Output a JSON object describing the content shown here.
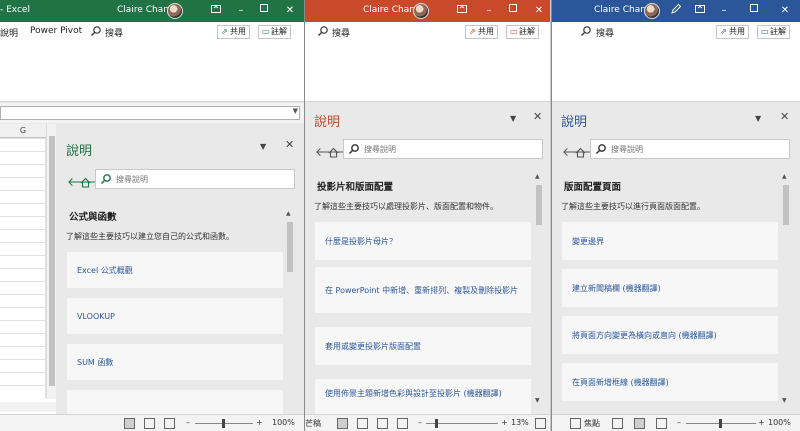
{
  "excel": {
    "title": "- Excel",
    "user": "Claire Chang",
    "ribbon_tabs": [
      "說明",
      "Power Pivot"
    ],
    "search_icon": "search-icon",
    "share_label": "共用",
    "comment_label": "註解",
    "column_header": "G",
    "help": {
      "title": "說明",
      "search_placeholder": "搜尋說明",
      "section_title": "公式與函數",
      "section_desc": "了解這些主要技巧以建立您自己的公式和函數。",
      "items": [
        "Excel 公式概觀",
        "VLOOKUP",
        "SUM 函數"
      ]
    },
    "zoom": "100%"
  },
  "powerpoint": {
    "user": "Claire Chang",
    "share_label": "共用",
    "comment_label": "註解",
    "help": {
      "title": "說明",
      "search_placeholder": "搜尋說明",
      "section_title": "投影片和版面配置",
      "section_desc": "了解這些主要技巧以處理投影片、版面配置和物件。",
      "items": [
        "什麼是投影片母片？",
        "在 PowerPoint 中新增、重新排列、複製及刪除投影片",
        "套用或變更投影片版面配置",
        "使用佈景主題新增色彩與設計至投影片 (機器翻譯)"
      ]
    },
    "status_left": "芒稿",
    "zoom": "13%"
  },
  "word": {
    "user": "Claire Chang",
    "share_label": "共用",
    "comment_label": "註解",
    "help": {
      "title": "說明",
      "search_placeholder": "搜尋說明",
      "section_title": "版面配置頁面",
      "section_desc": "了解這些主要技巧以進行頁面版面配置。",
      "items": [
        "變更邊界",
        "建立新聞稿欄 (機器翻譯)",
        "將頁面方向變更為橫向或直向 (機器翻譯)",
        "在頁面新增框線 (機器翻譯)"
      ]
    },
    "focus_label": "焦點",
    "zoom": "100%"
  },
  "colors": {
    "excel": "#217346",
    "powerpoint": "#c9492b",
    "word": "#2b579a",
    "link": "#2b579a"
  }
}
